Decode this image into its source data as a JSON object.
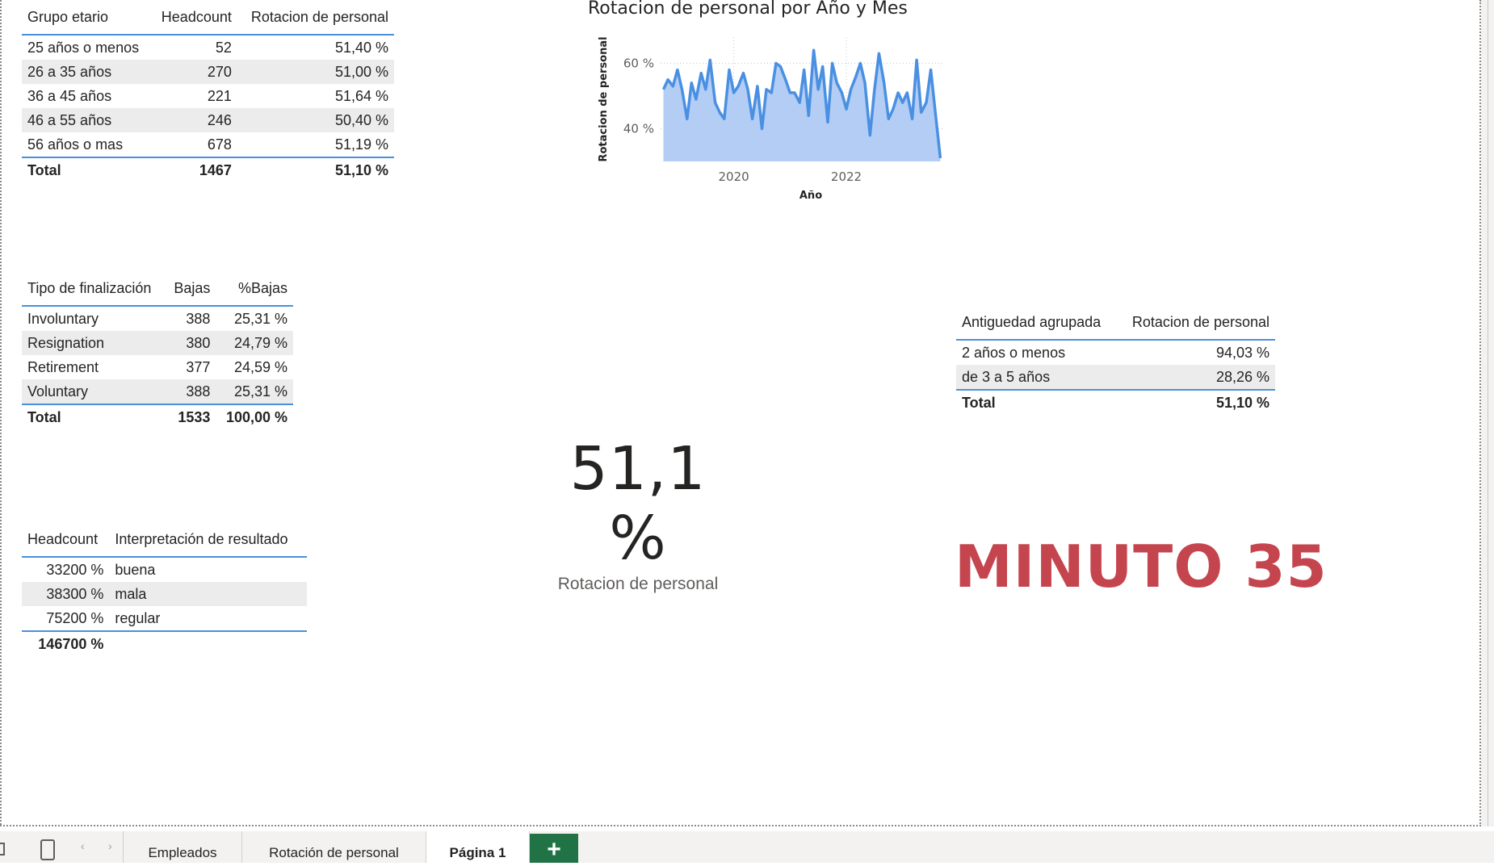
{
  "table_edad": {
    "headers": [
      "Grupo etario",
      "Headcount",
      "Rotacion de personal"
    ],
    "rows": [
      [
        "25 años o menos",
        "52",
        "51,40 %"
      ],
      [
        "26 a 35 años",
        "270",
        "51,00 %"
      ],
      [
        "36 a 45 años",
        "221",
        "51,64 %"
      ],
      [
        "46 a 55 años",
        "246",
        "50,40 %"
      ],
      [
        "56 años o mas",
        "678",
        "51,19 %"
      ]
    ],
    "total": [
      "Total",
      "1467",
      "51,10 %"
    ]
  },
  "table_finalizacion": {
    "headers": [
      "Tipo de finalización",
      "Bajas",
      "%Bajas"
    ],
    "rows": [
      [
        "Involuntary",
        "388",
        "25,31 %"
      ],
      [
        "Resignation",
        "380",
        "24,79 %"
      ],
      [
        "Retirement",
        "377",
        "24,59 %"
      ],
      [
        "Voluntary",
        "388",
        "25,31 %"
      ]
    ],
    "total": [
      "Total",
      "1533",
      "100,00 %"
    ]
  },
  "table_interpretacion": {
    "headers": [
      "Headcount",
      "Interpretación de resultado"
    ],
    "rows": [
      [
        "33200 %",
        "buena"
      ],
      [
        "38300 %",
        "mala"
      ],
      [
        "75200 %",
        "regular"
      ]
    ],
    "total": [
      "146700 %",
      ""
    ]
  },
  "table_antiguedad": {
    "headers": [
      "Antiguedad agrupada",
      "Rotacion de personal"
    ],
    "rows": [
      [
        "2 años o menos",
        "94,03 %"
      ],
      [
        "de 3 a 5 años",
        "28,26 %"
      ]
    ],
    "total": [
      "Total",
      "51,10 %"
    ]
  },
  "kpi": {
    "value": "51,1 %",
    "label": "Rotacion de personal"
  },
  "overlay_text": "MINUTO 35",
  "chart_data": {
    "type": "area",
    "title": "Rotacion de personal por Año y Mes",
    "xlabel": "Año",
    "ylabel": "Rotacion de personal",
    "x_ticks": [
      "2020",
      "2022"
    ],
    "y_ticks": [
      "40 %",
      "60 %"
    ],
    "ylim": [
      30,
      68
    ],
    "xlim": [
      2018.7,
      2023.75
    ],
    "grid": true,
    "color": "#4a90e2",
    "fill_color": "#b3cdf5",
    "x": [
      2018.75,
      2018.83,
      2018.92,
      2019.0,
      2019.08,
      2019.17,
      2019.25,
      2019.33,
      2019.42,
      2019.5,
      2019.58,
      2019.67,
      2019.75,
      2019.83,
      2019.92,
      2020.0,
      2020.08,
      2020.17,
      2020.25,
      2020.33,
      2020.42,
      2020.5,
      2020.58,
      2020.67,
      2020.75,
      2020.83,
      2020.92,
      2021.0,
      2021.08,
      2021.17,
      2021.25,
      2021.33,
      2021.42,
      2021.5,
      2021.58,
      2021.67,
      2021.75,
      2021.83,
      2021.92,
      2022.0,
      2022.08,
      2022.17,
      2022.25,
      2022.33,
      2022.42,
      2022.5,
      2022.58,
      2022.67,
      2022.75,
      2022.83,
      2022.92,
      2023.0,
      2023.08,
      2023.17,
      2023.25,
      2023.33,
      2023.42,
      2023.5,
      2023.58,
      2023.67
    ],
    "values": [
      52,
      55,
      53,
      58,
      52,
      43,
      54,
      49,
      57,
      52,
      61,
      48,
      45,
      43,
      58,
      51,
      53,
      57,
      52,
      43,
      53,
      40,
      52,
      51,
      60,
      59,
      55,
      51,
      51,
      48,
      58,
      44,
      64,
      52,
      59,
      42,
      60,
      54,
      51,
      46,
      52,
      56,
      60,
      54,
      38,
      52,
      63,
      54,
      43,
      46,
      51,
      48,
      51,
      43,
      61,
      45,
      48,
      58,
      45,
      31
    ]
  },
  "tabs": {
    "items": [
      "Empleados",
      "Rotación de personal",
      "Página 1"
    ],
    "add": "+"
  }
}
